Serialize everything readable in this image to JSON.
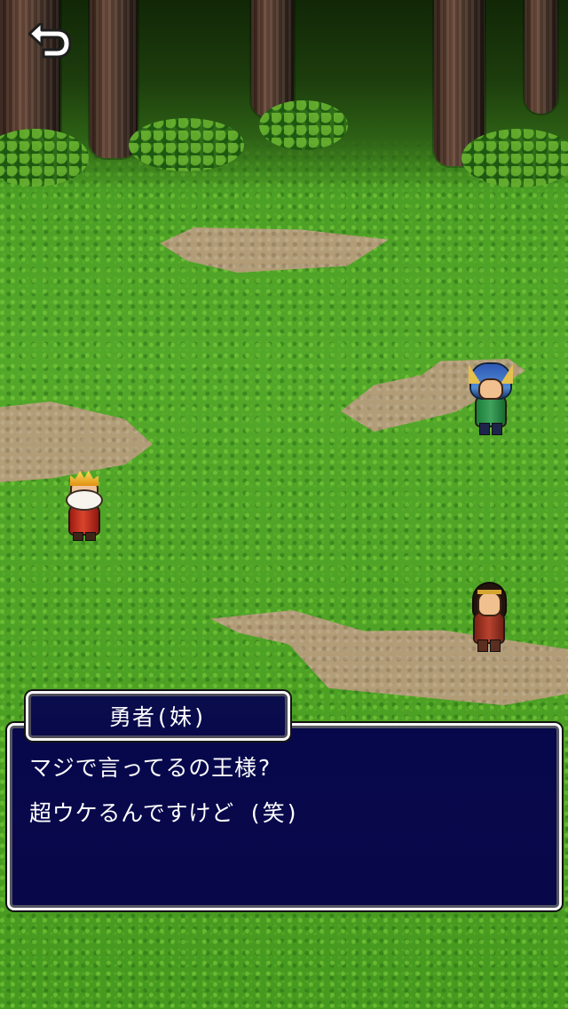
{
  "dialog": {
    "speaker": "勇者(妹)",
    "lines": [
      "マジで言ってるの王様?",
      "超ウケるんですけど (笑)"
    ]
  },
  "icons": {
    "back": "back-arrow-icon"
  },
  "colors": {
    "dialog_background": "#07084c",
    "dialog_border": "#f7f7f7",
    "grass": "#4ca225",
    "dirt": "#b79c7c",
    "text": "#ffffff"
  }
}
